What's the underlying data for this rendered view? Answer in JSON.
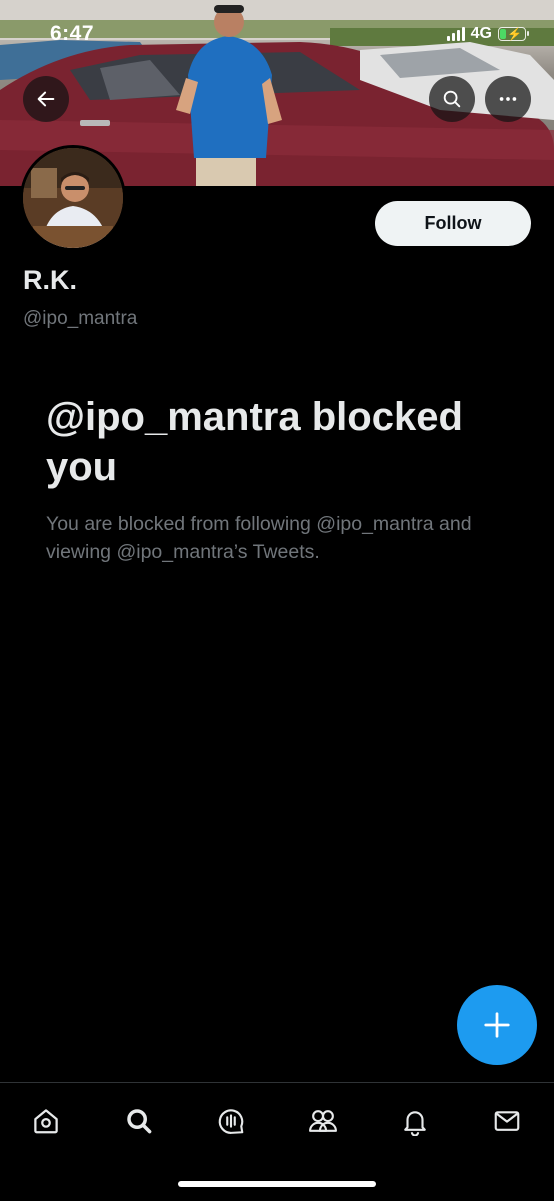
{
  "status_bar": {
    "time": "6:47",
    "network": "4G"
  },
  "profile": {
    "name": "R.K.",
    "handle": "@ipo_mantra",
    "follow_label": "Follow"
  },
  "blocked": {
    "title": "@ipo_mantra blocked you",
    "description": "You are blocked from following @ipo_mantra and viewing @ipo_mantra’s Tweets."
  },
  "icons": {
    "back": "back-arrow-icon",
    "search": "search-icon",
    "more": "more-icon",
    "compose": "plus-icon",
    "nav": [
      "home-icon",
      "search-icon",
      "spaces-icon",
      "communities-icon",
      "notifications-icon",
      "messages-icon"
    ]
  },
  "colors": {
    "accent": "#1d9bf0",
    "background": "#000000",
    "secondary_text": "#71767b"
  }
}
